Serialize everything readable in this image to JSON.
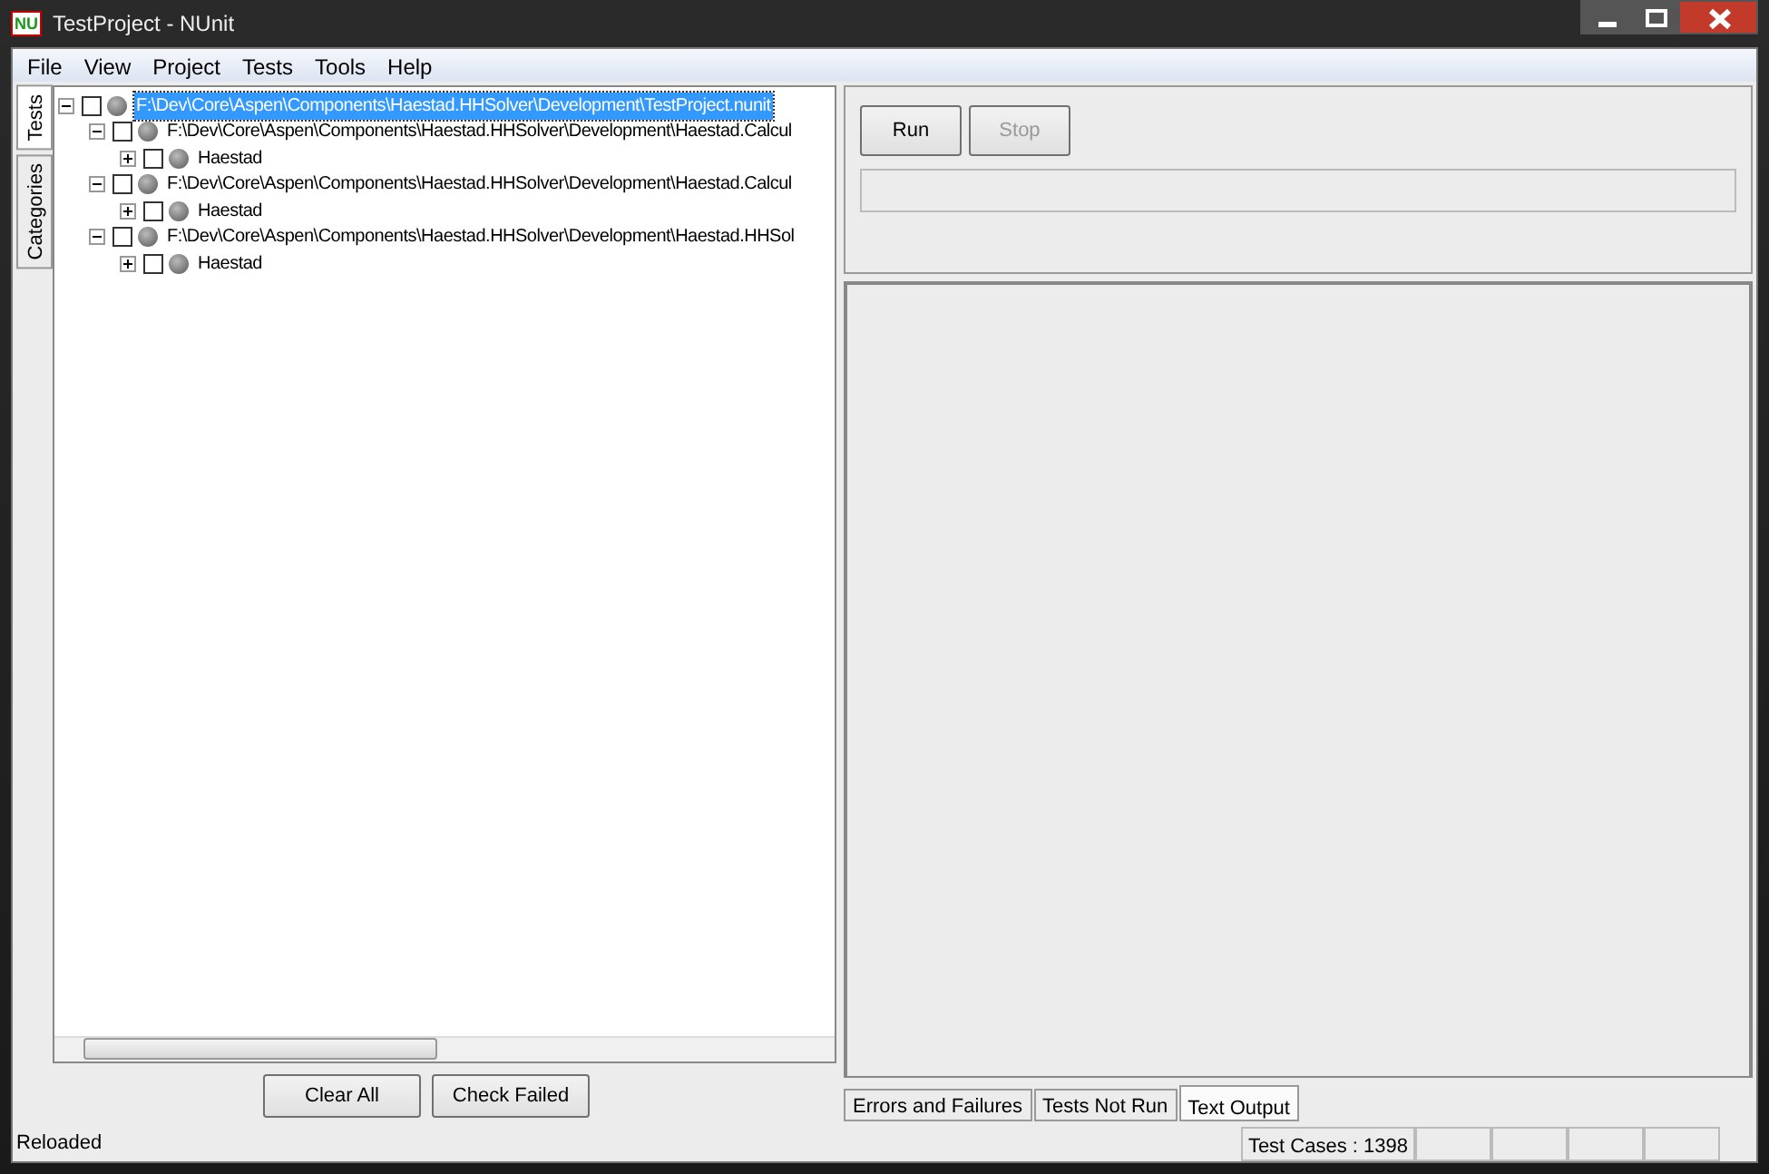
{
  "window": {
    "title": "TestProject - NUnit",
    "app_icon": "NU"
  },
  "menu": [
    "File",
    "View",
    "Project",
    "Tests",
    "Tools",
    "Help"
  ],
  "side_tabs": [
    {
      "label": "Tests",
      "selected": true
    },
    {
      "label": "Categories",
      "selected": false
    }
  ],
  "tree": [
    {
      "label": "F:\\Dev\\Core\\Aspen\\Components\\Haestad.HHSolver\\Development\\TestProject.nunit",
      "expanded": true,
      "checked": false,
      "selected": true,
      "children": [
        {
          "label": "F:\\Dev\\Core\\Aspen\\Components\\Haestad.HHSolver\\Development\\Haestad.Calcul",
          "expanded": true,
          "checked": false,
          "selected": false,
          "children": [
            {
              "label": "Haestad",
              "expanded": false,
              "checked": false,
              "selected": false
            }
          ]
        },
        {
          "label": "F:\\Dev\\Core\\Aspen\\Components\\Haestad.HHSolver\\Development\\Haestad.Calcul",
          "expanded": true,
          "checked": false,
          "selected": false,
          "children": [
            {
              "label": "Haestad",
              "expanded": false,
              "checked": false,
              "selected": false
            }
          ]
        },
        {
          "label": "F:\\Dev\\Core\\Aspen\\Components\\Haestad.HHSolver\\Development\\Haestad.HHSol",
          "expanded": true,
          "checked": false,
          "selected": false,
          "children": [
            {
              "label": "Haestad",
              "expanded": false,
              "checked": false,
              "selected": false
            }
          ]
        }
      ]
    }
  ],
  "tree_buttons": [
    "Clear All",
    "Check Failed"
  ],
  "run_buttons": [
    {
      "label": "Run",
      "disabled": false
    },
    {
      "label": "Stop",
      "disabled": true
    }
  ],
  "progress": {
    "level": 0
  },
  "result_tabs": [
    {
      "label": "Errors and Failures",
      "selected": false
    },
    {
      "label": "Tests Not Run",
      "selected": false
    },
    {
      "label": "Text Output",
      "selected": true
    }
  ],
  "status_bar": {
    "message": "Reloaded",
    "panels": [
      "Test Cases : 1398"
    ]
  }
}
